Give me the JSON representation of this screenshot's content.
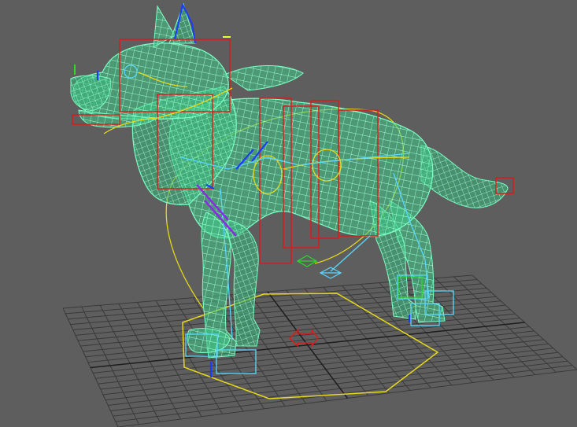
{
  "viewport": {
    "background_color": "#5e5e5e",
    "grid_color": "#3a3a3a",
    "grid_axis_color": "#1e1e1e"
  },
  "model": {
    "subject": "dog",
    "display_mode": "wireframe",
    "mesh_color": "#5cf2b0",
    "mesh_dark_color": "#2e8a5c"
  },
  "rig": {
    "joint_color": "#5ad8ff",
    "selection_color": "#1a3cff",
    "control_box_color": "#e01818",
    "control_circle_color": "#e6d81a",
    "locator_color": "#2bd82b",
    "ik_handle_color": "#8a2be2"
  },
  "icons": {
    "origin_marker": "red-cross-locator-icon",
    "foot_locator": "diamond-locator-icon"
  }
}
